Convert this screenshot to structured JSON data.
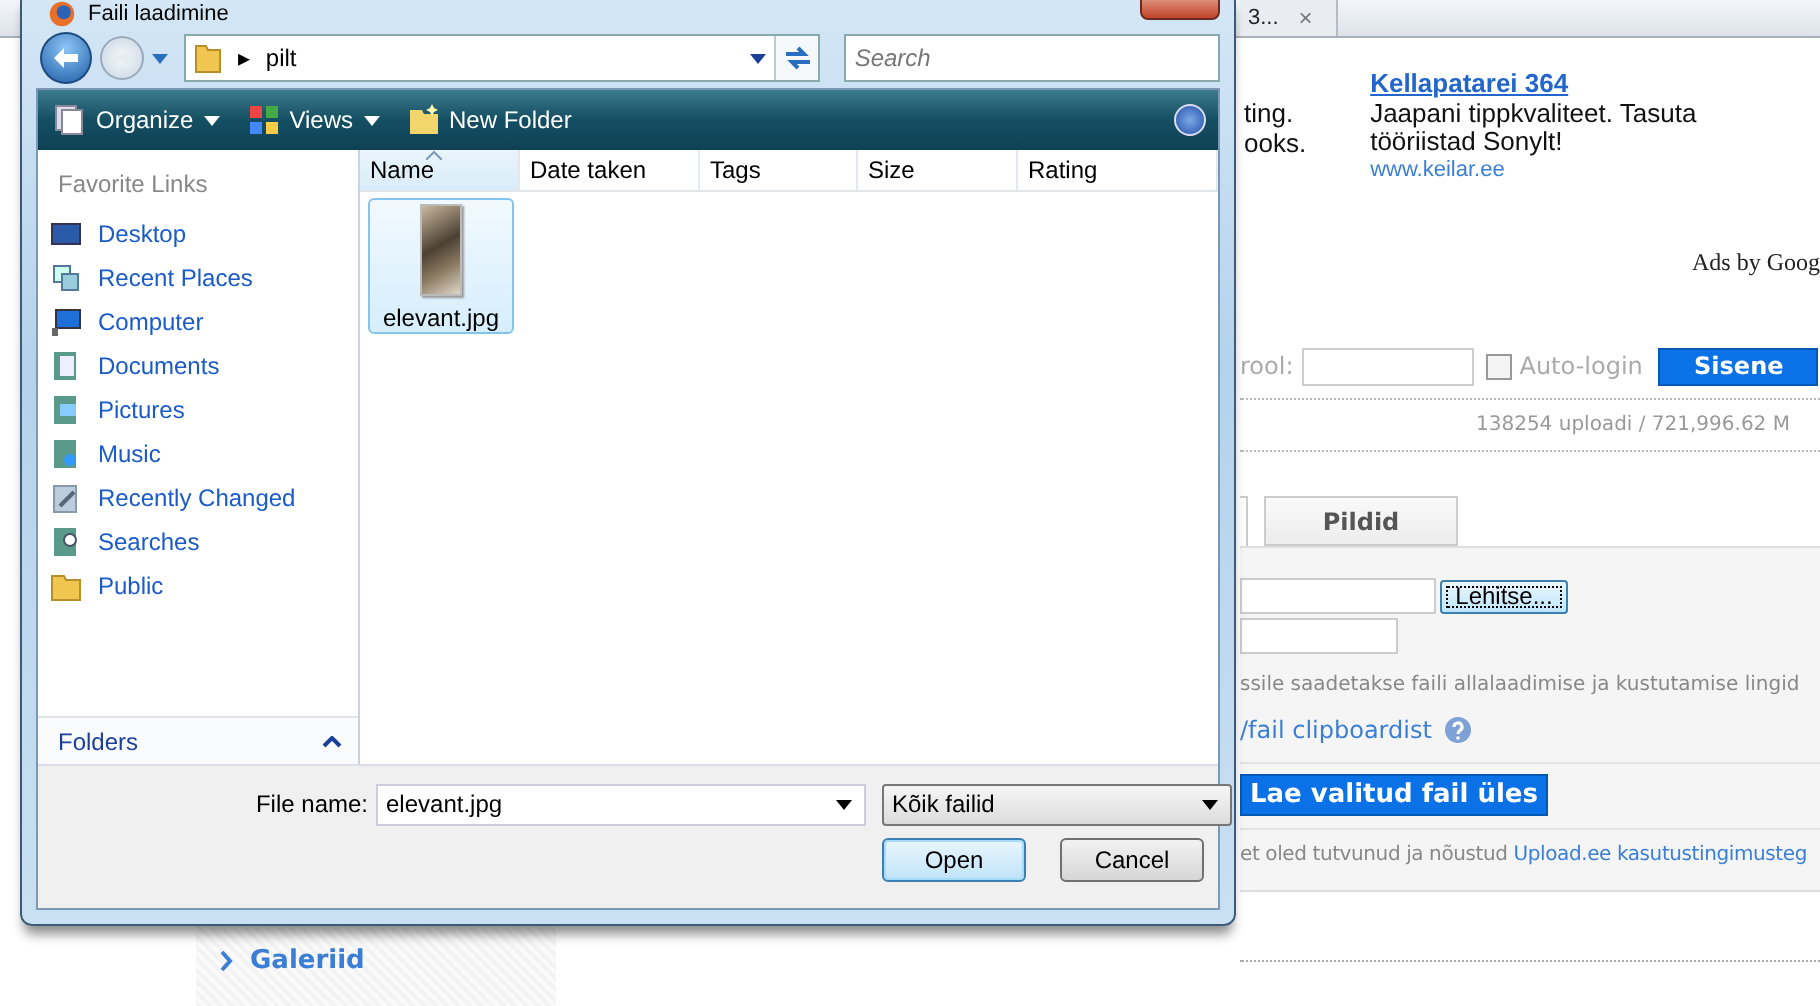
{
  "browser_tab": {
    "title": "3...",
    "close": "×"
  },
  "ads": {
    "cut_lines": [
      "ting.",
      "ooks."
    ],
    "title": "Kellapatarei 364",
    "text": "Jaapani tippkvaliteet. Tasuta tööriistad Sonylt!",
    "url": "www.keilar.ee",
    "footer": "Ads by Goog"
  },
  "login": {
    "label": "rool:",
    "autologin": {
      "label": "Auto-login",
      "checked": false
    },
    "button": "Sisene"
  },
  "stats": "138254 uploadi  /  721,996.62 M",
  "page_tabs": [
    {
      "label": "Pildid",
      "selected": false
    }
  ],
  "upload_form": {
    "browse_button": "Lehitse...",
    "email_note": "ssile saadetakse faili allalaadimise ja kustutamise lingid",
    "clipboard_link": "/fail clipboardist",
    "upload_button": "Lae valitud fail üles",
    "terms_text": "et oled tutvunud ja nõustud ",
    "terms_link": "Upload.ee kasutustingimusteg"
  },
  "sidebar_link": "Galeriid",
  "dialog": {
    "title": "Faili laadimine",
    "address": {
      "separator": "▸",
      "folder": "pilt"
    },
    "search_placeholder": "Search",
    "toolbar": [
      {
        "label": "Organize",
        "dropdown": true
      },
      {
        "label": "Views",
        "dropdown": true
      },
      {
        "label": "New Folder",
        "dropdown": false
      }
    ],
    "favorites_title": "Favorite Links",
    "favorites": [
      {
        "label": "Desktop"
      },
      {
        "label": "Recent Places"
      },
      {
        "label": "Computer"
      },
      {
        "label": "Documents"
      },
      {
        "label": "Pictures"
      },
      {
        "label": "Music"
      },
      {
        "label": "Recently Changed"
      },
      {
        "label": "Searches"
      },
      {
        "label": "Public"
      }
    ],
    "folders_label": "Folders",
    "folders_expanded": false,
    "columns": [
      {
        "label": "Name",
        "selected": true
      },
      {
        "label": "Date taken",
        "selected": false
      },
      {
        "label": "Tags",
        "selected": false
      },
      {
        "label": "Size",
        "selected": false
      },
      {
        "label": "Rating",
        "selected": false
      }
    ],
    "files": [
      {
        "name": "elevant.jpg",
        "selected": true
      }
    ],
    "file_name_label": "File name:",
    "file_name": "elevant.jpg",
    "file_type": "Kõik failid",
    "buttons": [
      {
        "label": "Open",
        "default": true
      },
      {
        "label": "Cancel",
        "default": false
      }
    ]
  }
}
